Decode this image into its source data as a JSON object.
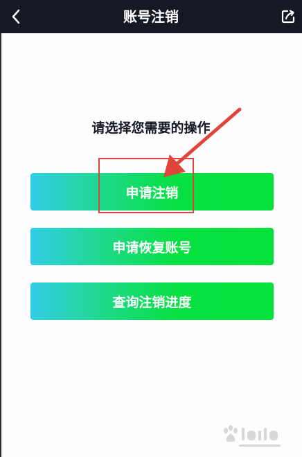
{
  "nav": {
    "title": "账号注销",
    "back_icon": "chevron-left-icon",
    "share_icon": "share-external-icon"
  },
  "main": {
    "prompt": "请选择您需要的操作",
    "buttons": [
      {
        "label": "申请注销"
      },
      {
        "label": "申请恢复账号"
      },
      {
        "label": "查询注销进度"
      }
    ]
  },
  "colors": {
    "nav_background": "#161823",
    "page_background": "#fdfdff",
    "button_gradient_start": "#33cce6",
    "button_gradient_end": "#05e13b",
    "annotation": "#e0453a"
  }
}
